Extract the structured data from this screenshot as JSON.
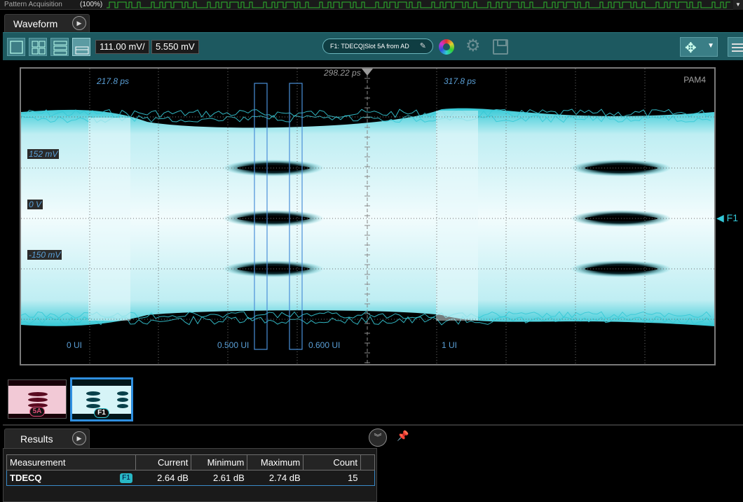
{
  "status": {
    "label": "Pattern Acquisition",
    "percent": "(100%)",
    "progress": 1.0,
    "pattern_color": "#2eb82e"
  },
  "waveform_tab": {
    "label": "Waveform",
    "play_icon": "play-circle-icon"
  },
  "toolbar": {
    "layout_icons": [
      "single-view-icon",
      "grid-view-icon",
      "stacked-view-icon",
      "overlay-view-icon"
    ],
    "scale": "111.00 mV/",
    "offset": "5.550 mV",
    "source_chip": "F1: TDECQ|Slot 5A from AD",
    "icons": [
      "color-wheel-icon",
      "gear-icon",
      "save-icon",
      "move-icon",
      "menu-icon"
    ],
    "accent": "#1d5960"
  },
  "plot": {
    "top_time_left": "217.8 ps",
    "top_time_mid": "298.22 ps",
    "top_time_right": "317.8 ps",
    "mode": "PAM4",
    "mv_labels": [
      "152 mV",
      "0 V",
      "-150 mV"
    ],
    "ui_labels": [
      "0 UI",
      "0.500 UI",
      "0.600 UI",
      "1 UI"
    ],
    "marker_label": "F1",
    "trace_color": "#36c9d6",
    "eye_center_color": "#e8f8fa"
  },
  "thumbnails": [
    {
      "badge": "5A",
      "color": "#e0507a"
    },
    {
      "badge": "F1",
      "color": "#36c9d6",
      "selected": true
    }
  ],
  "results": {
    "tab_label": "Results",
    "columns": [
      "Measurement",
      "Current",
      "Minimum",
      "Maximum",
      "Count"
    ],
    "rows": [
      {
        "measurement": "TDECQ",
        "badge": "F1",
        "current": "2.64 dB",
        "minimum": "2.61 dB",
        "maximum": "2.74 dB",
        "count": "15"
      }
    ]
  }
}
